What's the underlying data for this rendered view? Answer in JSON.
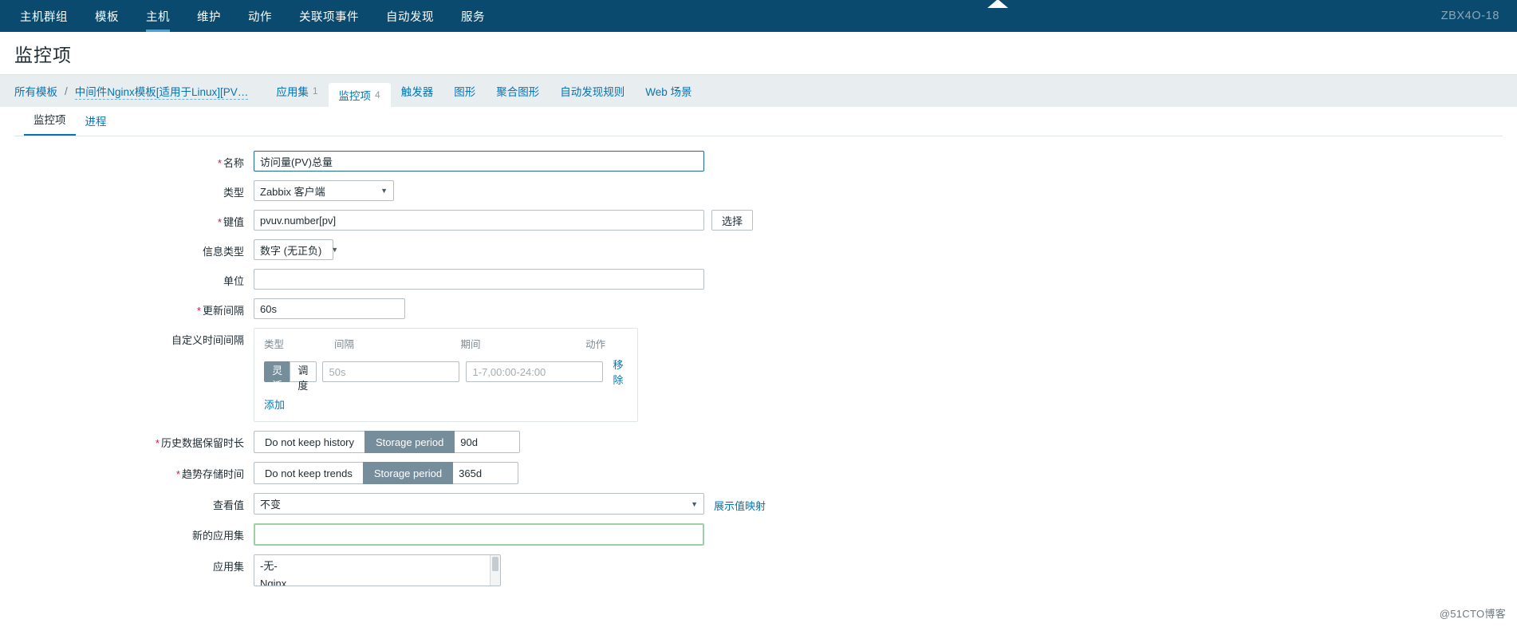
{
  "topnav": {
    "items": [
      {
        "label": "主机群组",
        "active": false
      },
      {
        "label": "模板",
        "active": false
      },
      {
        "label": "主机",
        "active": true
      },
      {
        "label": "维护",
        "active": false
      },
      {
        "label": "动作",
        "active": false
      },
      {
        "label": "关联项事件",
        "active": false
      },
      {
        "label": "自动发现",
        "active": false
      },
      {
        "label": "服务",
        "active": false
      }
    ],
    "user": "ZBX4O-18"
  },
  "page": {
    "title": "监控项"
  },
  "breadcrumb": {
    "root": "所有模板",
    "separator": "/",
    "current": "中间件Nginx模板[适用于Linux][PV…",
    "tabs": [
      {
        "label": "应用集",
        "count": "1",
        "active": false
      },
      {
        "label": "监控项",
        "count": "4",
        "active": true
      },
      {
        "label": "触发器",
        "count": "",
        "active": false
      },
      {
        "label": "图形",
        "count": "",
        "active": false
      },
      {
        "label": "聚合图形",
        "count": "",
        "active": false
      },
      {
        "label": "自动发现规则",
        "count": "",
        "active": false
      },
      {
        "label": "Web 场景",
        "count": "",
        "active": false
      }
    ]
  },
  "subtabs": [
    {
      "label": "监控项",
      "active": true
    },
    {
      "label": "进程",
      "active": false
    }
  ],
  "form": {
    "name": {
      "label": "名称",
      "required": true,
      "value": "访问量(PV)总量"
    },
    "type": {
      "label": "类型",
      "required": false,
      "value": "Zabbix 客户端"
    },
    "key": {
      "label": "键值",
      "required": true,
      "value": "pvuv.number[pv]",
      "select_button": "选择"
    },
    "info_type": {
      "label": "信息类型",
      "required": false,
      "value": "数字 (无正负)"
    },
    "units": {
      "label": "单位",
      "required": false,
      "value": ""
    },
    "update_interval": {
      "label": "更新间隔",
      "required": true,
      "value": "60s"
    },
    "custom_intervals": {
      "label": "自定义时间间隔",
      "headers": {
        "type": "类型",
        "interval": "间隔",
        "period": "期间",
        "action": "动作"
      },
      "rows": [
        {
          "flexible_label": "灵活",
          "scheduling_label": "调度",
          "mode": "flexible",
          "interval_placeholder": "50s",
          "interval_value": "",
          "period_placeholder": "1-7,00:00-24:00",
          "period_value": "",
          "remove_label": "移除"
        }
      ],
      "add_label": "添加"
    },
    "history": {
      "label": "历史数据保留时长",
      "required": true,
      "off_label": "Do not keep history",
      "on_label": "Storage period",
      "mode": "storage",
      "value": "90d"
    },
    "trends": {
      "label": "趋势存储时间",
      "required": true,
      "off_label": "Do not keep trends",
      "on_label": "Storage period",
      "mode": "storage",
      "value": "365d"
    },
    "value_map": {
      "label": "查看值",
      "value": "不变",
      "link_label": "展示值映射"
    },
    "new_application": {
      "label": "新的应用集",
      "value": ""
    },
    "applications": {
      "label": "应用集",
      "options": [
        {
          "label": "-无-",
          "selected": true
        },
        {
          "label": "Nginx",
          "selected": false
        }
      ]
    }
  },
  "watermark": "@51CTO博客",
  "colors": {
    "nav_bg": "#0a4a6e",
    "accent": "#0275b8",
    "crumb_bg": "#e8edf0",
    "segment_on": "#768d9b",
    "required": "#dd1144",
    "green_border": "#9ed0a8"
  }
}
